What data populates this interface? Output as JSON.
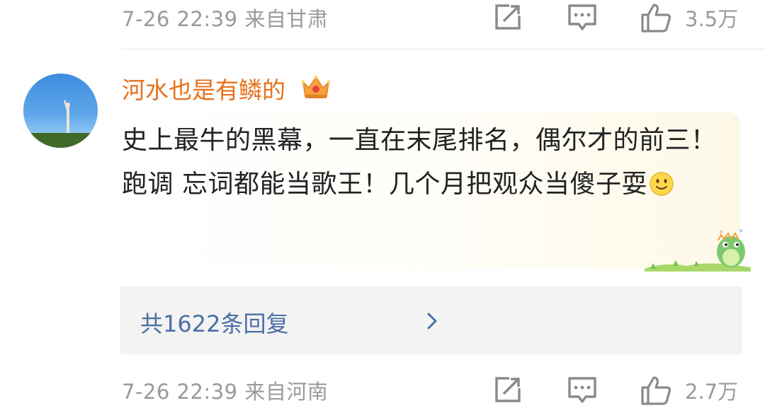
{
  "top_meta": {
    "time": "7-26 22:39",
    "location": "来自甘肃",
    "like_count": "3.5万"
  },
  "comment": {
    "username": "河水也是有鳞的",
    "text": "史上最牛的黑幕，一直在末尾排名，偶尔才的前三！ 跑调 忘词都能当歌王！几个月把观众当傻子耍",
    "reply_summary": "共1622条回复"
  },
  "bottom_meta": {
    "time": "7-26 22:39",
    "location": "来自河南",
    "like_count": "2.7万"
  },
  "icons": {
    "repost": "repost-icon",
    "comment": "comment-icon",
    "like": "thumbs-up-icon",
    "vip": "crown-badge-icon",
    "emoji": "smile-emoji-icon",
    "chevron": "chevron-right-icon"
  },
  "colors": {
    "username": "#e8711a",
    "reply_link": "#4a6fa5",
    "meta_gray": "#9a9a9a",
    "reply_bg": "#f3f3f3"
  }
}
